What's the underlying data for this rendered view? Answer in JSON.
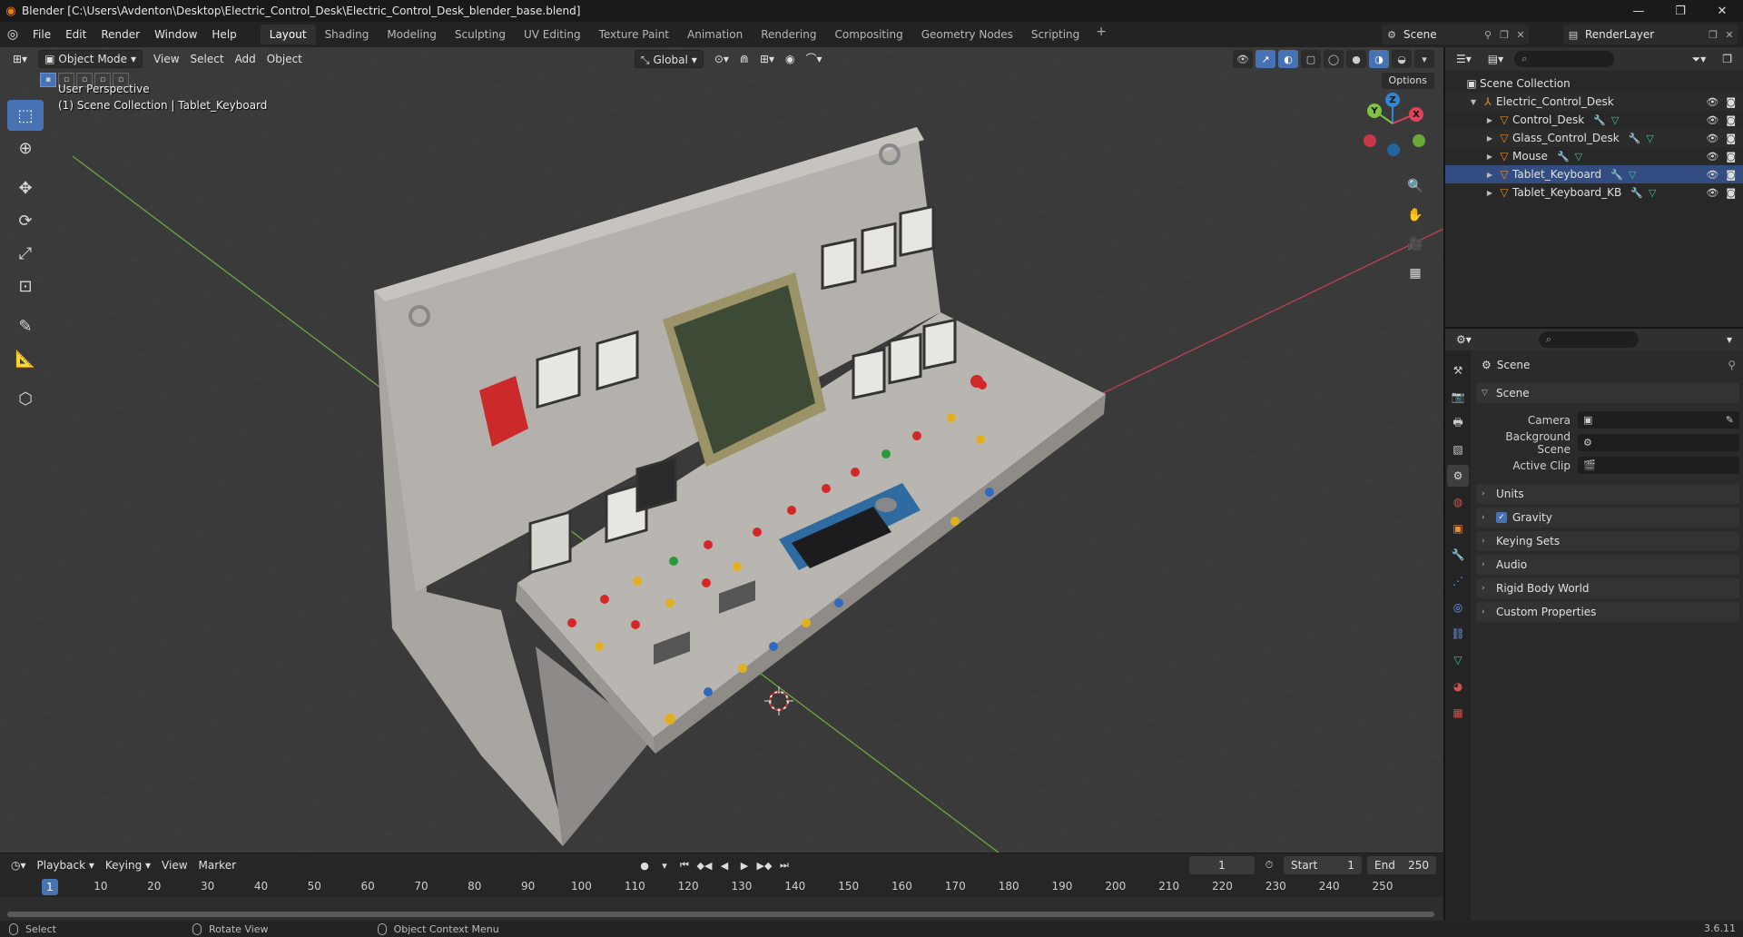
{
  "window": {
    "title": "Blender [C:\\Users\\Avdenton\\Desktop\\Electric_Control_Desk\\Electric_Control_Desk_blender_base.blend]",
    "controls": [
      "—",
      "❐",
      "✕"
    ]
  },
  "menus": [
    "File",
    "Edit",
    "Render",
    "Window",
    "Help"
  ],
  "workspaces": [
    "Layout",
    "Shading",
    "Modeling",
    "Sculpting",
    "UV Editing",
    "Texture Paint",
    "Animation",
    "Rendering",
    "Compositing",
    "Geometry Nodes",
    "Scripting"
  ],
  "workspace_add": "+",
  "scene_name": "Scene",
  "view_layer": "RenderLayer",
  "viewport": {
    "mode": "Object Mode",
    "menus": [
      "View",
      "Select",
      "Add",
      "Object"
    ],
    "transform_orientation": "Global",
    "options_label": "Options",
    "info_line1": "User Perspective",
    "info_line2": "(1) Scene Collection | Tablet_Keyboard",
    "gizmo": {
      "x": "X",
      "y": "Y",
      "z": "Z"
    }
  },
  "timeline": {
    "menus": [
      "Playback",
      "Keying",
      "View",
      "Marker"
    ],
    "current_frame": "1",
    "frame_display": "1",
    "start_label": "Start",
    "start_value": "1",
    "end_label": "End",
    "end_value": "250",
    "ticks": [
      "1",
      "10",
      "20",
      "30",
      "40",
      "50",
      "60",
      "70",
      "80",
      "90",
      "100",
      "110",
      "120",
      "130",
      "140",
      "150",
      "160",
      "170",
      "180",
      "190",
      "200",
      "210",
      "220",
      "230",
      "240",
      "250"
    ]
  },
  "status": {
    "select": "Select",
    "rotate": "Rotate View",
    "context": "Object Context Menu",
    "version": "3.6.11"
  },
  "outliner": {
    "root": "Scene Collection",
    "collection": "Electric_Control_Desk",
    "objects": [
      "Control_Desk",
      "Glass_Control_Desk",
      "Mouse",
      "Tablet_Keyboard",
      "Tablet_Keyboard_KB"
    ]
  },
  "properties": {
    "crumb": "Scene",
    "scene_panel": "Scene",
    "camera_label": "Camera",
    "background_label": "Background Scene",
    "clip_label": "Active Clip",
    "panels": [
      "Units",
      "Gravity",
      "Keying Sets",
      "Audio",
      "Rigid Body World",
      "Custom Properties"
    ]
  },
  "colors": {
    "accent": "#4772b3",
    "axis_x": "#e0435a",
    "axis_y": "#7ec242",
    "axis_z": "#2f86d6",
    "object_orange": "#e88d2d"
  }
}
